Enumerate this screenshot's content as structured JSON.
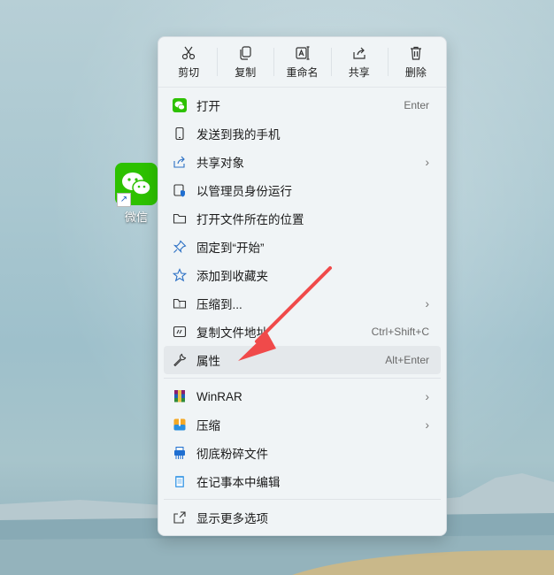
{
  "desktop": {
    "icon_label": "微信"
  },
  "toolbar": [
    {
      "label": "剪切",
      "icon": "scissors-icon"
    },
    {
      "label": "复制",
      "icon": "copy-icon"
    },
    {
      "label": "重命名",
      "icon": "rename-icon"
    },
    {
      "label": "共享",
      "icon": "share-icon"
    },
    {
      "label": "删除",
      "icon": "trash-icon"
    }
  ],
  "menu": {
    "group1": [
      {
        "label": "打开",
        "shortcut": "Enter",
        "icon": "wechat-icon"
      },
      {
        "label": "发送到我的手机",
        "shortcut": "",
        "icon": "phone-icon"
      },
      {
        "label": "共享对象",
        "shortcut": "",
        "icon": "share-icon",
        "submenu": true
      },
      {
        "label": "以管理员身份运行",
        "shortcut": "",
        "icon": "admin-shield-icon"
      },
      {
        "label": "打开文件所在的位置",
        "shortcut": "",
        "icon": "folder-icon"
      },
      {
        "label": "固定到“开始”",
        "shortcut": "",
        "icon": "pin-icon"
      },
      {
        "label": "添加到收藏夹",
        "shortcut": "",
        "icon": "star-icon"
      },
      {
        "label": "压缩到...",
        "shortcut": "",
        "icon": "zip-folder-icon",
        "submenu": true
      },
      {
        "label": "复制文件地址",
        "shortcut": "Ctrl+Shift+C",
        "icon": "copy-path-icon"
      },
      {
        "label": "属性",
        "shortcut": "Alt+Enter",
        "icon": "wrench-icon",
        "highlighted": true
      }
    ],
    "group2": [
      {
        "label": "WinRAR",
        "icon": "winrar-icon",
        "submenu": true
      },
      {
        "label": "压缩",
        "icon": "compress-icon",
        "submenu": true
      },
      {
        "label": "彻底粉碎文件",
        "icon": "shredder-icon"
      },
      {
        "label": "在记事本中编辑",
        "icon": "notepad-icon"
      }
    ],
    "group3": [
      {
        "label": "显示更多选项",
        "icon": "more-options-icon"
      }
    ]
  },
  "chevron": "›",
  "colors": {
    "accent": "#2dc100",
    "arrow": "#f04a4a"
  }
}
